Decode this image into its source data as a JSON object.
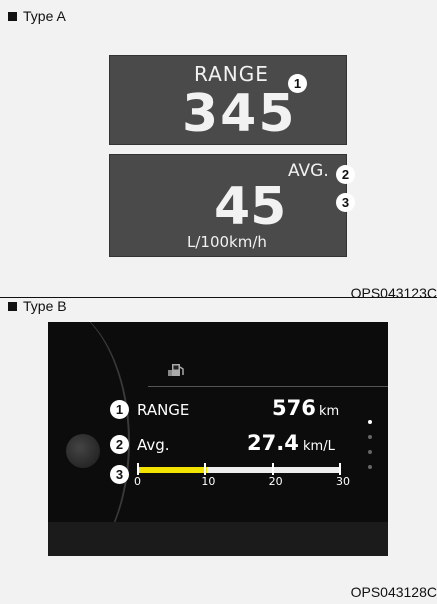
{
  "type_a": {
    "label": "Type A",
    "top_display": {
      "label": "RANGE",
      "value": "345"
    },
    "bottom_display": {
      "label": "AVG.",
      "value": "45",
      "unit": "L/100km/h"
    },
    "callouts": [
      "1",
      "2",
      "3"
    ],
    "code": "OPS043123C"
  },
  "type_b": {
    "label": "Type B",
    "header_icon": "fuel-pump-icon",
    "range": {
      "callout": "1",
      "label": "RANGE",
      "value": "576",
      "unit": "km"
    },
    "avg": {
      "callout": "2",
      "label": "Avg.",
      "value": "27.4",
      "unit": "km/L"
    },
    "gauge": {
      "callout": "3",
      "fill_fraction": 0.34,
      "ticks": [
        "0",
        "10",
        "20",
        "30"
      ]
    },
    "page_indicator": {
      "count": 4,
      "active_index": 0
    },
    "code": "OPS043128C"
  },
  "colors": {
    "lcd_bg": "#4a4a4a",
    "panel_bg": "#0c0c0c",
    "gauge_fill": "#f3e300"
  }
}
